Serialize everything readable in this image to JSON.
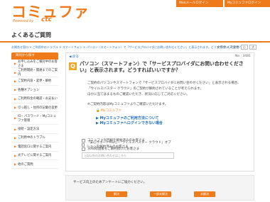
{
  "header": {
    "logo_text": "コミュファ",
    "logo_sub": "Powered by",
    "logo_brand": "ctc",
    "buttons": [
      "Webメールログイン",
      "Myコミュファログイン"
    ]
  },
  "page_title": "よくあるご質問",
  "breadcrumb": "お問合せ窓口 > ご利用中のトラブル > スマートフォン > パソコン（スマートフォン）で「サービスプロバイダにお問い合わせください」と表示されます。どうすればいいですか？",
  "font_size": {
    "label": "文字サイズ変更",
    "small": "小",
    "large": "大"
  },
  "sidebar": {
    "header": "目的から探す",
    "items": [
      "お申し込みをご検討中のお客さま",
      "ご利用開始・開通までのご案内",
      "ご契約内容・変更・解約",
      "各種オプション",
      "ご利用料金の確認・お支払い",
      "引っ越し・住所の記載の変更",
      "ID・パスワード・Myコミュファ管理",
      "接続・設定方法",
      "ご利用中のトラブル",
      "電話窓口に関するご案内",
      "光テレビに関するご案内",
      "他のご質問"
    ]
  },
  "main": {
    "return_label": "◀ 戻る",
    "no_label": "No : 3481",
    "q_badge": "Q",
    "question": "パソコン（スマートフォン）で「サービスプロバイダにお問い合わせください」と表示されます。どうすればいいですか？",
    "answer_lines": [
      "ご契約のパソコンやスマートフォンで「サービスプロバイダにお問い合わせください」と表示される場合、",
      "「ウイルスバスター クラウド」のご契約が解約されていることが考えられます。",
      "ほかに当てはまるものご確認いただき、状況に応じてご対応ください。",
      "※ご契約内容はMyコミュファよりご確認いただけます。"
    ],
    "mylink_label": "Myコミュファ",
    "links": [
      "Myコミュファのご利用方法について",
      "Myコミュファへログインできない場合"
    ]
  },
  "feedback": {
    "options": [
      "コミュファ光回線を解約済みのお客さま",
      "「安心サポートPlus」・「ウイルスバスター クラウド」オプションを解約済みのお客さま",
      "30日経過後もご解約続けたお客さま"
    ],
    "input_placeholder": "上記以外のお問い合わせはこちら"
  },
  "survey": {
    "question": "サービス向上のためアンケートにご協力ください。",
    "buttons": [
      "解決",
      "一部未解決",
      "未解決"
    ]
  }
}
